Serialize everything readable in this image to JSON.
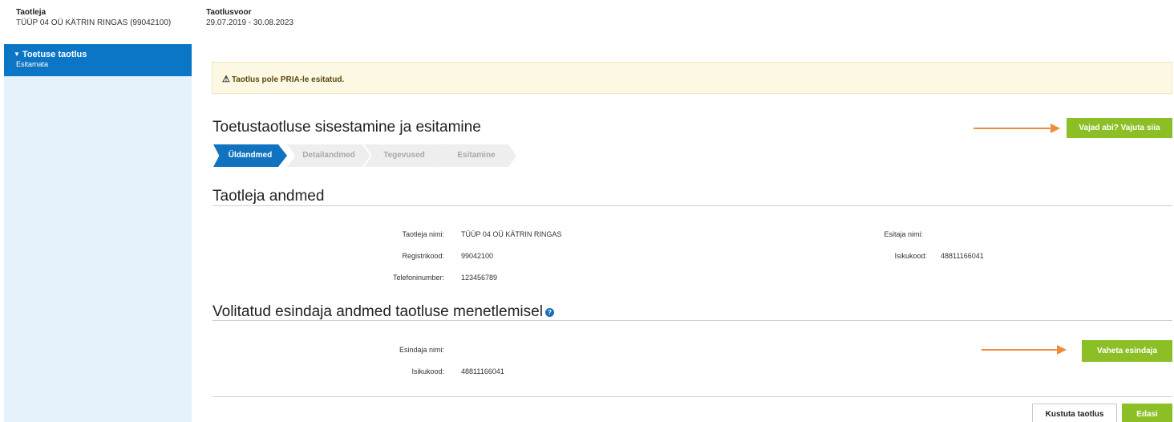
{
  "header": {
    "applicant_label": "Taotleja",
    "applicant_value": "TÜÜP 04 OÜ KÄTRIN RINGAS (99042100)",
    "round_label": "Taotlusvoor",
    "round_value": "29.07.2019 - 30.08.2023"
  },
  "sidebar": {
    "items": [
      {
        "label": "Toetuse taotlus",
        "status": "Esitamata",
        "active": true
      }
    ]
  },
  "alert": {
    "icon": "warning-icon",
    "text": "Taotlus pole PRIA-le esitatud."
  },
  "main": {
    "title": "Toetustaotluse sisestamine ja esitamine",
    "help_button": "Vajad abi? Vajuta siia",
    "steps": [
      {
        "label": "Üldandmed",
        "active": true
      },
      {
        "label": "Detailandmed",
        "active": false
      },
      {
        "label": "Tegevused",
        "active": false
      },
      {
        "label": "Esitamine",
        "active": false
      }
    ]
  },
  "applicant_section": {
    "title": "Taotleja andmed",
    "fields": {
      "name_label": "Taotleja nimi:",
      "name_value": "TÜÜP 04 OÜ KÄTRIN RINGAS",
      "regcode_label": "Registrikood:",
      "regcode_value": "99042100",
      "phone_label": "Telefoninumber:",
      "phone_value": "123456789",
      "submitter_label": "Esitaja nimi:",
      "submitter_value": "",
      "idcode_label": "Isikukood:",
      "idcode_value": "48811166041"
    }
  },
  "representative_section": {
    "title": "Volitatud esindaja andmed taotluse menetlemisel",
    "help_icon": "question-icon",
    "fields": {
      "name_label": "Esindaja nimi:",
      "name_value": "",
      "idcode_label": "Isikukood:",
      "idcode_value": "48811166041"
    },
    "change_button": "Vaheta esindaja"
  },
  "footer": {
    "delete_button": "Kustuta taotlus",
    "next_button": "Edasi"
  },
  "colors": {
    "primary_blue": "#0b76c5",
    "green": "#8cbf26",
    "arrow_orange": "#f08a3c",
    "alert_bg": "#fcf8e3",
    "sidebar_bg": "#e6f2fb"
  }
}
